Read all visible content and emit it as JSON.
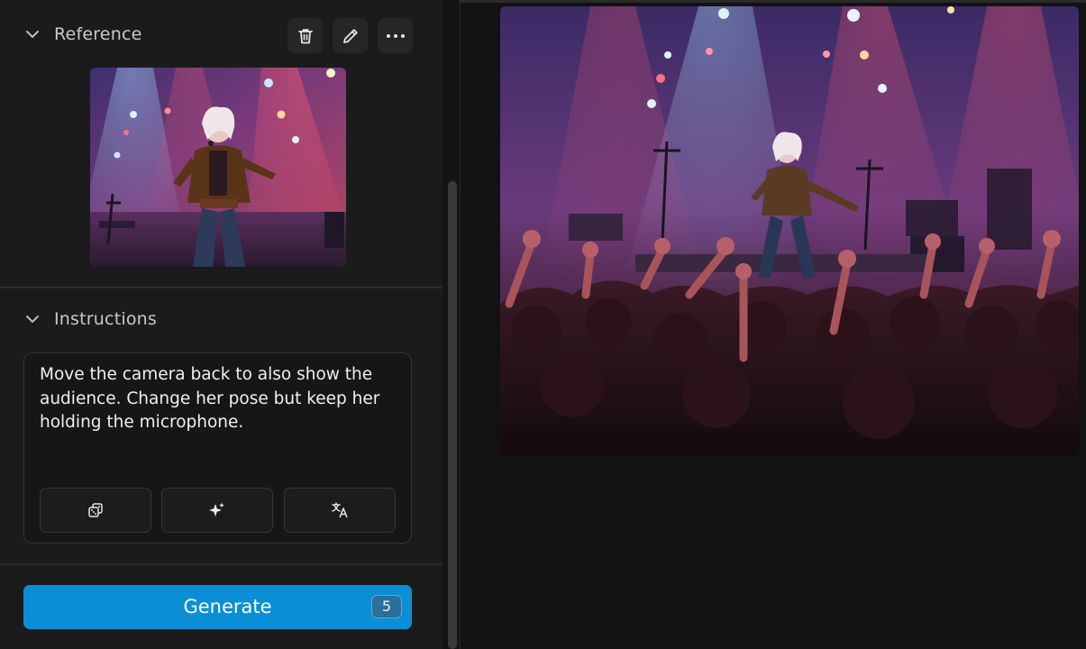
{
  "reference": {
    "title": "Reference",
    "toolbar": {
      "delete_icon": "trash-icon",
      "edit_icon": "pencil-icon",
      "more_icon": "more-horizontal-icon"
    }
  },
  "instructions": {
    "title": "Instructions",
    "text": "Move the camera back to also show the audience. Change her pose but keep her holding the microphone.",
    "actions": [
      {
        "icon": "dice-icon"
      },
      {
        "icon": "sparkles-icon"
      },
      {
        "icon": "translate-icon"
      }
    ]
  },
  "generate": {
    "label": "Generate",
    "credits": "5"
  },
  "colors": {
    "accent": "#0a8fd6",
    "panel": "#1b1b1b",
    "background": "#121212"
  }
}
